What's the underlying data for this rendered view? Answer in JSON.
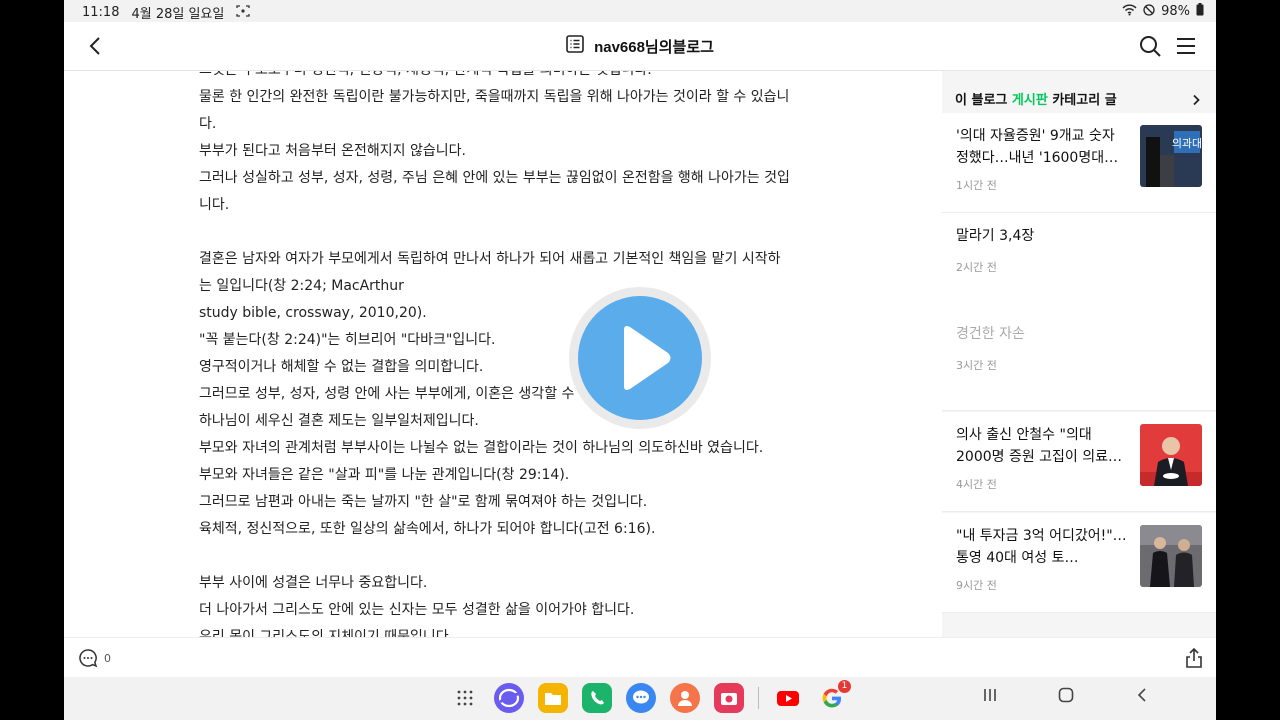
{
  "status": {
    "time": "11:18",
    "date": "4월 28일 일요일",
    "battery": "98%"
  },
  "header": {
    "title": "nav668님의블로그"
  },
  "article": {
    "lines": [
      "그것은 부모로부터 정신적, 신앙적, 재정적, 관계적 독립을 의미하는 것입니다.",
      "물론 한 인간의 완전한 독립이란 불가능하지만, 죽을때까지 독립을 위해 나아가는  것이라 할 수 있습니",
      "다.",
      "부부가 된다고 처음부터 온전해지지 않습니다.",
      "그러나 성실하고 성부, 성자, 성령, 주님 은혜 안에 있는 부부는 끊임없이 온전함을 행해 나아가는 것입",
      "니다.",
      "",
      "결혼은 남자와 여자가 부모에게서 독립하여 만나서 하나가 되어 새롭고 기본적인 책임을 맡기 시작하",
      "는 일입니다(창 2:24; MacArthur",
      "study bible, crossway, 2010,20).",
      "\"꼭 붙는다(창 2:24)\"는 히브리어 \"다바크\"입니다.",
      "영구적이거나 해체할 수 없는 결합을 의미합니다.",
      "그러므로 성부, 성자, 성령 안에 사는 부부에게, 이혼은 생각할 수",
      "하나님이 세우신 결혼 제도는 일부일처제입니다.",
      "부모와 자녀의 관계처럼 부부사이는 나뉠수 없는 결합이라는 것이 하나님의 의도하신바 였습니다.",
      "부모와 자녀들은 같은 \"살과 피\"를 나눈 관계입니다(창 29:14).",
      "그러므로 남편과 아내는 죽는 날까지 \"한 살\"로 함께 묶여져야 하는 것입니다.",
      "육체적, 정신적으로, 또한 일상의 삶속에서, 하나가 되어야 합니다(고전 6:16).",
      "",
      "부부 사이에 성결은 너무나 중요합니다.",
      "더 나아가서 그리스도 안에 있는 신자는 모두 성결한 삶을 이어가야 합니다.",
      "우리 몸이 그리스도의 지체이기 때문입니다."
    ]
  },
  "sidebar": {
    "header_prefix": "이 블로그 ",
    "header_board": "게시판",
    "header_suffix": " 카테고리 글",
    "items": [
      {
        "title": "'의대 자율증원' 9개교 숫자 정했다…내년 '1600명대…",
        "time": "1시간 전",
        "has_thumb": true
      },
      {
        "title": "말라기 3,4장",
        "time": "2시간 전",
        "has_thumb": false
      },
      {
        "title": "경건한 자손",
        "time": "3시간 전",
        "has_thumb": false
      },
      {
        "title": "의사 출신 안철수 \"의대 2000명 증원 고집이 의료…",
        "time": "4시간 전",
        "has_thumb": true
      },
      {
        "title": "\"내 투자금 3억 어디갔어!\"…통영 40대 여성 토…",
        "time": "9시간 전",
        "has_thumb": true
      }
    ],
    "thumb1_text": "의과대"
  },
  "bottombar": {
    "comment_count": "0"
  },
  "dock": {
    "google_badge": "1"
  },
  "colors": {
    "accent_green": "#03c75a",
    "play_blue": "#5aaceb"
  }
}
